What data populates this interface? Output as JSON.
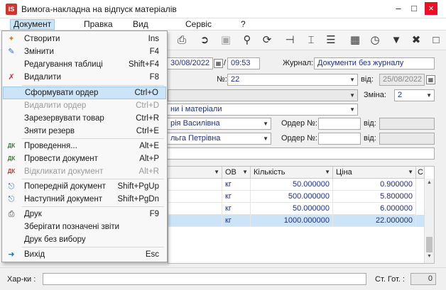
{
  "window": {
    "title": "Вимога-накладна на відпуск матеріалів",
    "app_icon": "ІS"
  },
  "menubar": [
    "Документ",
    "Правка",
    "Вид",
    "Сервіс",
    "?"
  ],
  "header": {
    "date_value": "30/08/2022",
    "date_sep": "/",
    "time_value": "09:53",
    "journal_label": "Журнал:",
    "journal_value": "Документи без журналу",
    "number_label": "№:",
    "number_value": "22",
    "vid_label": "від:",
    "vid_value": "",
    "vid2_value": "25/08/2022",
    "zmina_label": "Зміна:",
    "zmina_value": "2",
    "materials_value": "ни і матеріали",
    "person1_value": "рія Василівна",
    "person2_value": "льга Петрівна",
    "order1_label": "Ордер №:",
    "order2_label": "Ордер №:",
    "vid_order1_label": "від:",
    "vid_order2_label": "від:"
  },
  "grid": {
    "columns": [
      "ОВ",
      "Кількість",
      "Ціна",
      "С"
    ],
    "rows": [
      {
        "unit": "кг",
        "qty": "50.000000",
        "price": "0.900000"
      },
      {
        "unit": "кг",
        "qty": "500.000000",
        "price": "5.800000"
      },
      {
        "unit": "кг",
        "qty": "50.000000",
        "price": "6.000000"
      },
      {
        "unit": "кг",
        "qty": "1000.000000",
        "price": "22.000000"
      }
    ]
  },
  "footer": {
    "chars_label": "Хар-ки :",
    "chars_value": "",
    "st_label": "Ст. Гот. :",
    "st_value": "0"
  },
  "menu": {
    "items": [
      {
        "icon": "new-doc-icon",
        "label": "Створити",
        "shortcut": "Ins"
      },
      {
        "icon": "edit-icon",
        "label": "Змінити",
        "shortcut": "F4"
      },
      {
        "icon": "",
        "label": "Редагування таблиці",
        "shortcut": "Shift+F4"
      },
      {
        "icon": "delete-icon",
        "label": "Видалити",
        "shortcut": "F8"
      },
      {
        "icon": "",
        "label": "Сформувати ордер",
        "shortcut": "Ctrl+O"
      },
      {
        "icon": "",
        "label": "Видалити ордер",
        "shortcut": "Ctrl+D"
      },
      {
        "icon": "",
        "label": "Зарезервувати товар",
        "shortcut": "Ctrl+R"
      },
      {
        "icon": "",
        "label": "Зняти резерв",
        "shortcut": "Ctrl+E"
      },
      {
        "icon": "posting-icon",
        "label": "Проведення...",
        "shortcut": "Alt+E"
      },
      {
        "icon": "post-doc-icon",
        "label": "Провести документ",
        "shortcut": "Alt+P"
      },
      {
        "icon": "unpost-doc-icon",
        "label": "Відкликати документ",
        "shortcut": "Alt+R"
      },
      {
        "icon": "prev-doc-icon",
        "label": "Попередній документ",
        "shortcut": "Shift+PgUp"
      },
      {
        "icon": "next-doc-icon",
        "label": "Наступний документ",
        "shortcut": "Shift+PgDn"
      },
      {
        "icon": "print-icon",
        "label": "Друк",
        "shortcut": "F9"
      },
      {
        "icon": "",
        "label": "Зберігати позначені звіти",
        "shortcut": ""
      },
      {
        "icon": "",
        "label": "Друк без вибору",
        "shortcut": ""
      },
      {
        "icon": "exit-icon",
        "label": "Вихід",
        "shortcut": "Esc"
      }
    ]
  }
}
